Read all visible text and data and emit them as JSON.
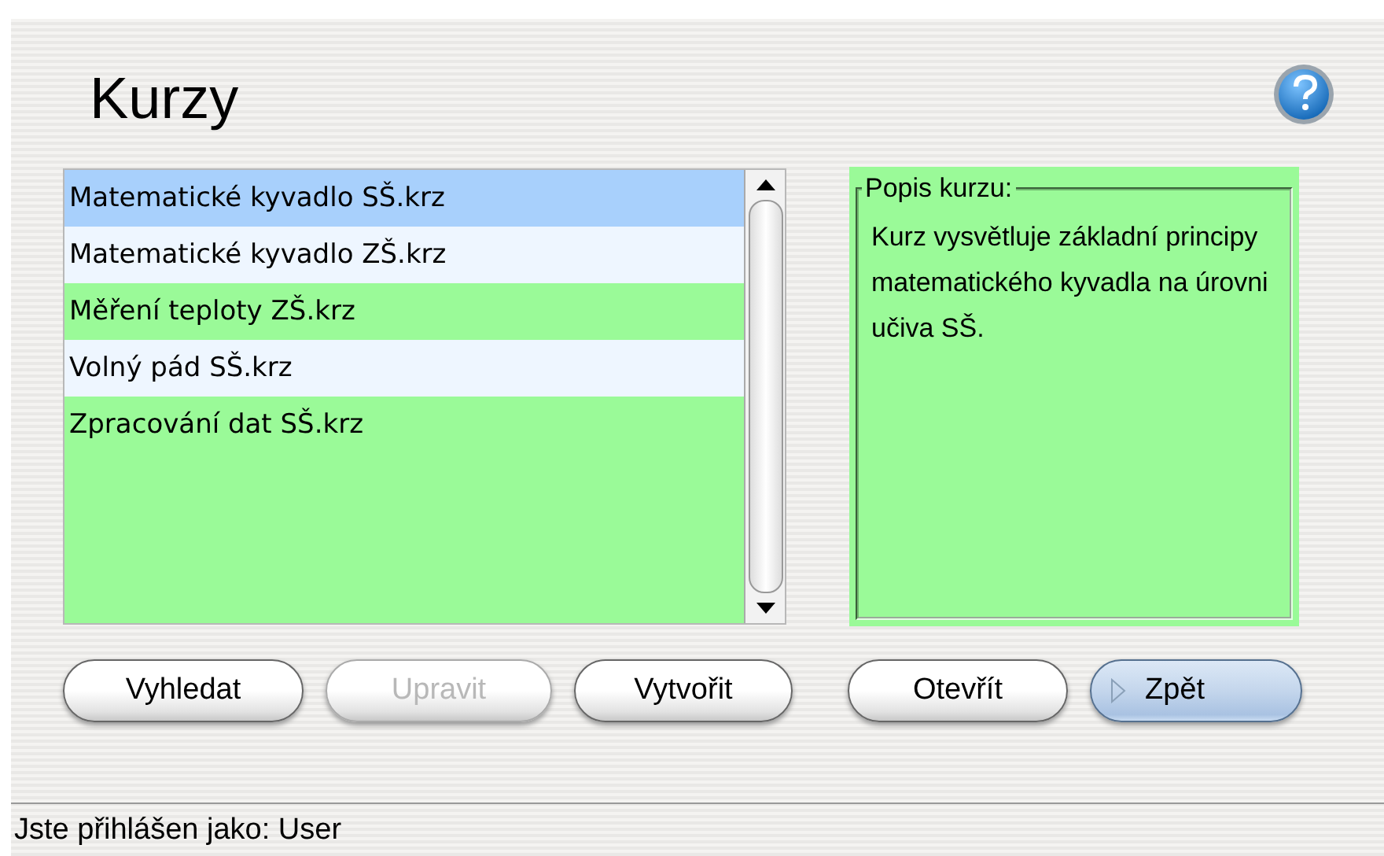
{
  "title": "Kurzy",
  "course_list": {
    "items": [
      {
        "label": "Matematické kyvadlo SŠ.krz",
        "selected": true
      },
      {
        "label": "Matematické kyvadlo ZŠ.krz",
        "selected": false
      },
      {
        "label": "Měření teploty ZŠ.krz",
        "selected": false
      },
      {
        "label": "Volný pád SŠ.krz",
        "selected": false
      },
      {
        "label": "Zpracování dat SŠ.krz",
        "selected": false
      }
    ]
  },
  "description": {
    "legend": "Popis kurzu:",
    "text": "Kurz vysvětluje základní principy matematického kyvadla na úrovni učiva SŠ."
  },
  "buttons": [
    {
      "label": "Vyhledat",
      "disabled": false,
      "default": false
    },
    {
      "label": "Upravit",
      "disabled": true,
      "default": false
    },
    {
      "label": "Vytvořit",
      "disabled": false,
      "default": false
    },
    {
      "label": "Otevřít",
      "disabled": false,
      "default": false
    },
    {
      "label": "Zpět",
      "disabled": false,
      "default": true
    }
  ],
  "status_bar": "Jste přihlášen jako: User"
}
